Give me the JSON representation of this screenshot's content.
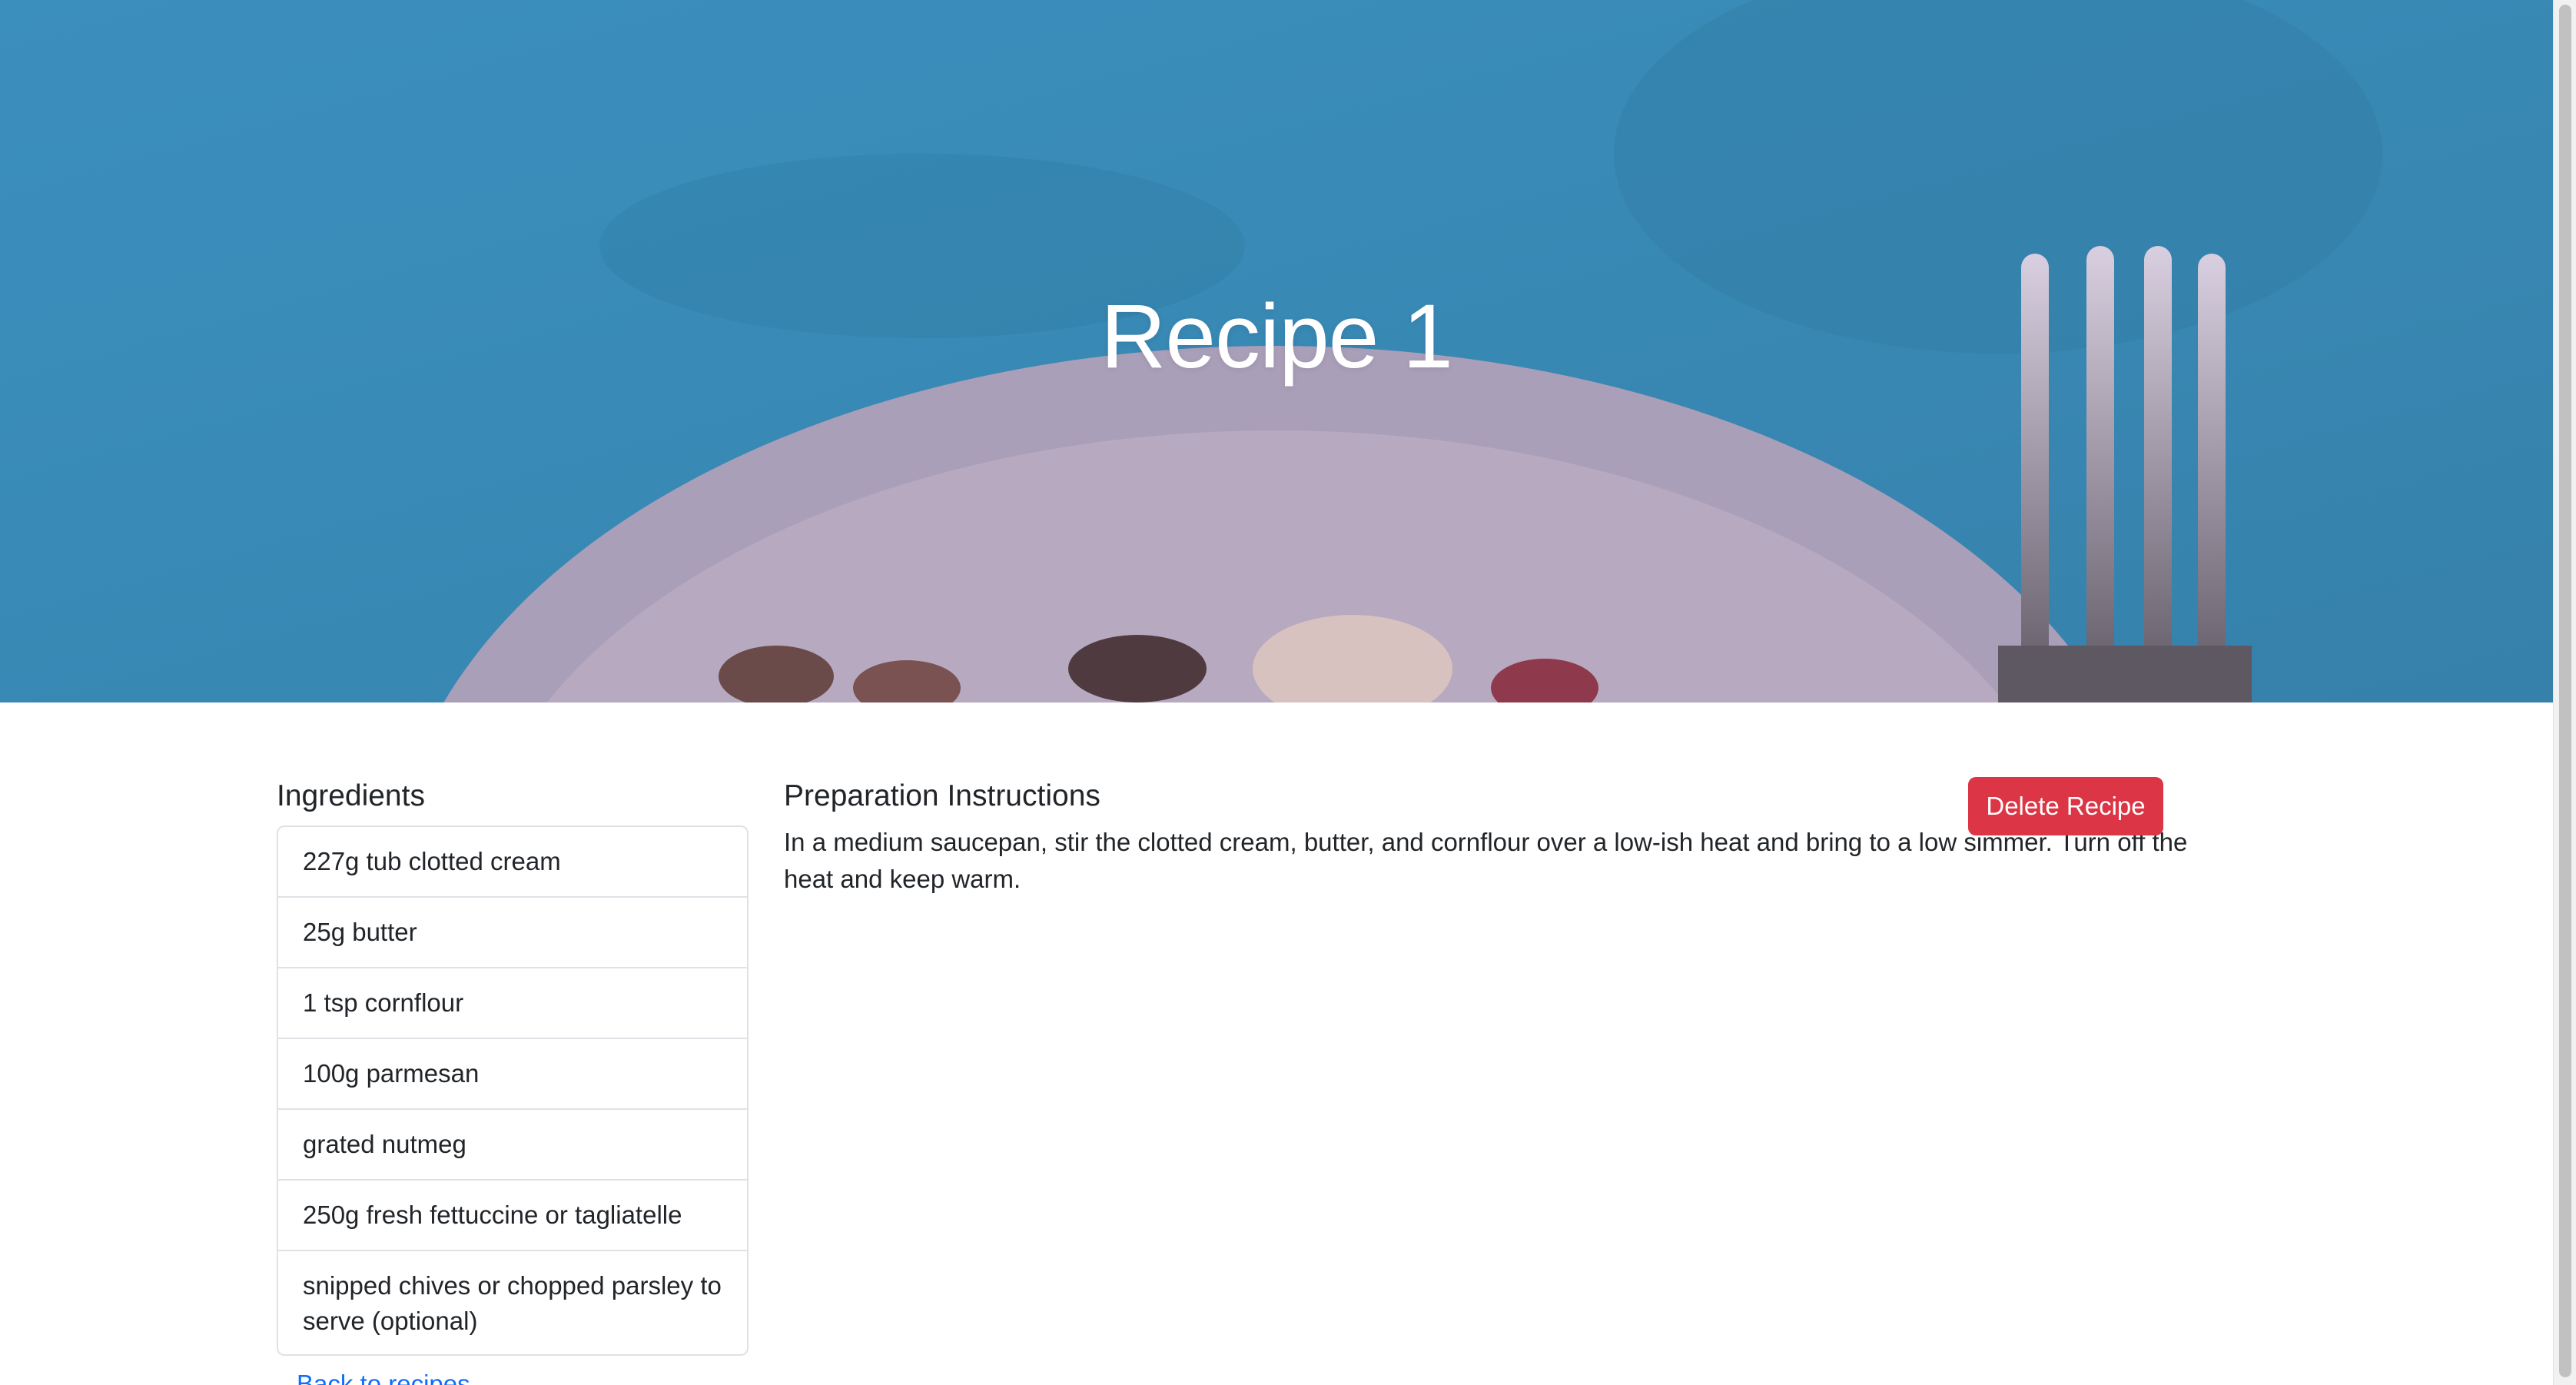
{
  "hero": {
    "title": "Recipe 1"
  },
  "ingredients": {
    "heading": "Ingredients",
    "items": [
      "227g tub clotted cream",
      "25g butter",
      "1 tsp cornflour",
      "100g parmesan",
      "grated nutmeg",
      "250g fresh fettuccine or tagliatelle",
      "snipped chives or chopped parsley to serve (optional)"
    ]
  },
  "instructions": {
    "heading": "Preparation Instructions",
    "text": "In a medium saucepan, stir the clotted cream, butter, and cornflour over a low-ish heat and bring to a low simmer. Turn off the heat and keep warm."
  },
  "actions": {
    "delete_label": "Delete Recipe",
    "back_label": "Back to recipes"
  },
  "colors": {
    "danger": "#dc3545",
    "link": "#0d6efd",
    "hero_blue": "#3a93c4"
  }
}
